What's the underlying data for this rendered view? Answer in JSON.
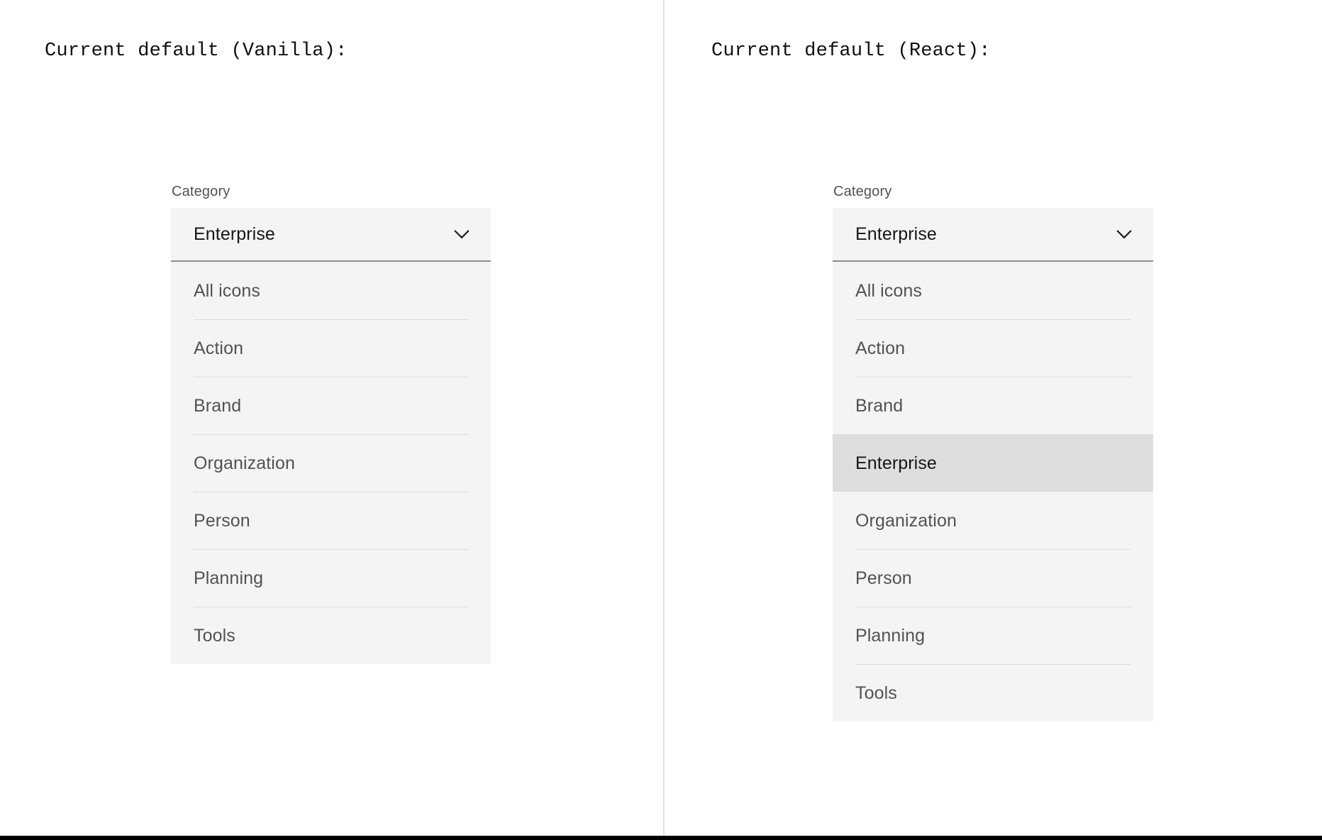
{
  "panels": [
    {
      "heading": "Current default (Vanilla):",
      "dropdown": {
        "label": "Category",
        "selected_value": "Enterprise",
        "chevron_icon": "chevron-down-icon",
        "expanded": true,
        "options": [
          "All icons",
          "Action",
          "Brand",
          "Organization",
          "Person",
          "Planning",
          "Tools"
        ],
        "highlighted_option": null
      }
    },
    {
      "heading": "Current default (React):",
      "dropdown": {
        "label": "Category",
        "selected_value": "Enterprise",
        "chevron_icon": "chevron-down-icon",
        "expanded": true,
        "options": [
          "All icons",
          "Action",
          "Brand",
          "Enterprise",
          "Organization",
          "Person",
          "Planning",
          "Tools"
        ],
        "highlighted_option": "Enterprise"
      }
    }
  ],
  "colors": {
    "page_background": "#ffffff",
    "field_background": "#f4f4f4",
    "selected_row_background": "#dedede",
    "field_underline": "#8d8d8d",
    "option_divider": "#dcdcdc",
    "split_divider": "#e2e2e2",
    "text_primary": "#161616",
    "text_secondary": "#525252",
    "bottom_rule": "#000000"
  }
}
